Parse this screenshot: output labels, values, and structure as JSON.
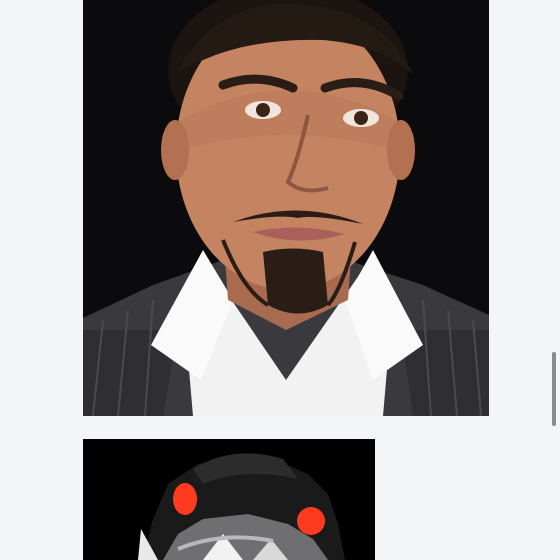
{
  "feed": {
    "images": [
      {
        "kind": "photo",
        "subject": "man-portrait"
      },
      {
        "kind": "illustration",
        "subject": "cartoon-character"
      }
    ]
  },
  "colors": {
    "background": "#f4f5f8",
    "photo_bg": "#0b0b0d",
    "cartoon_bg": "#000000",
    "cartoon_eyes": "#ff3b1f",
    "scrollbar": "#8a8a8f"
  }
}
